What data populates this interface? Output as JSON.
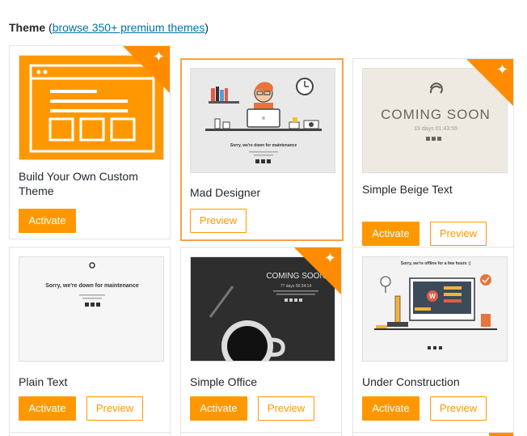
{
  "header": {
    "title": "Theme",
    "paren_open": "(",
    "link": "browse 350+ premium themes",
    "paren_close": ")"
  },
  "themes": [
    {
      "name": "Build Your Own Custom Theme",
      "premium": true,
      "selected": false,
      "activate_label": "Activate",
      "preview_label": ""
    },
    {
      "name": "Mad Designer",
      "premium": false,
      "selected": true,
      "activate_label": "",
      "preview_label": "Preview",
      "thumb_title": "Sorry, we're down for maintenance"
    },
    {
      "name": "Simple Beige Text",
      "premium": true,
      "selected": false,
      "activate_label": "Activate",
      "preview_label": "Preview",
      "thumb_title": "COMING SOON",
      "thumb_sub": "19 days 01:43:55"
    },
    {
      "name": "Plain Text",
      "premium": false,
      "selected": false,
      "activate_label": "Activate",
      "preview_label": "Preview",
      "thumb_title": "Sorry, we're down for maintenance"
    },
    {
      "name": "Simple Office",
      "premium": true,
      "selected": false,
      "activate_label": "Activate",
      "preview_label": "Preview",
      "thumb_title": "COMING SOON",
      "thumb_sub": "77 days 00:34:14"
    },
    {
      "name": "Under Construction",
      "premium": false,
      "selected": false,
      "activate_label": "Activate",
      "preview_label": "Preview",
      "thumb_title": "Sorry, we're offline for a few hours :("
    }
  ],
  "colors": {
    "accent": "#ff9800",
    "link": "#0073aa",
    "selected_border": "#f6a24b"
  }
}
